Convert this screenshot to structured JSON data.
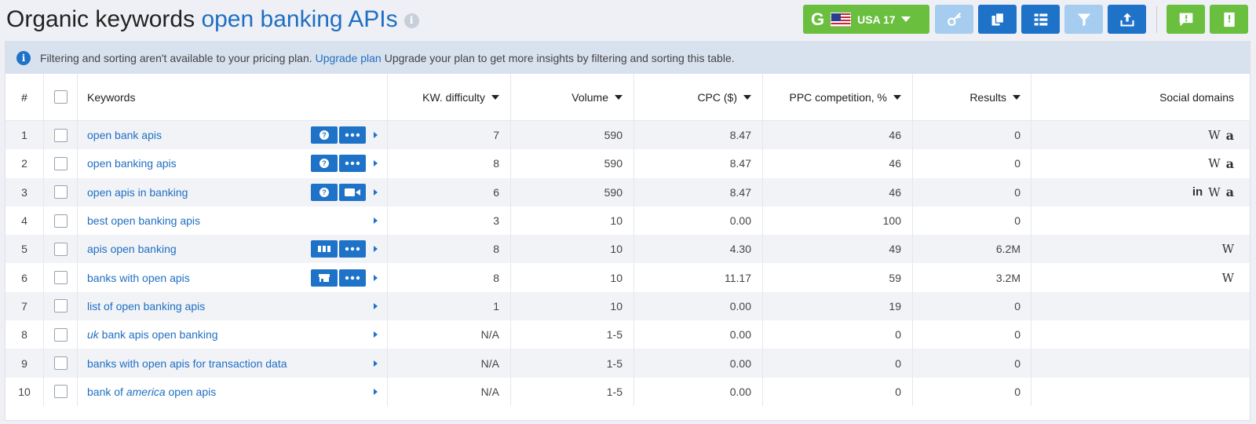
{
  "header": {
    "title_prefix": "Organic keywords",
    "title_query": "open banking APIs",
    "database": {
      "engine_letter": "G",
      "label": "USA 17"
    },
    "toolbar": [
      "key-icon",
      "copy-icon",
      "columns-icon",
      "filter-icon",
      "export-icon",
      "feedback-icon",
      "guide-icon"
    ]
  },
  "notice": {
    "text_before": "Filtering and sorting aren't available to your pricing plan.",
    "link": "Upgrade plan",
    "text_after": "Upgrade your plan to get more insights by filtering and sorting this table."
  },
  "table": {
    "columns": {
      "num": "#",
      "keywords": "Keywords",
      "kd": "KW. difficulty",
      "volume": "Volume",
      "cpc": "CPC ($)",
      "ppc": "PPC competition, %",
      "results": "Results",
      "social": "Social domains"
    },
    "rows": [
      {
        "n": "1",
        "kw": [
          "open bank apis"
        ],
        "tools": [
          "question",
          "more"
        ],
        "kd": "7",
        "vol": "590",
        "cpc": "8.47",
        "ppc": "46",
        "res": "0",
        "social": [
          "W",
          "a"
        ]
      },
      {
        "n": "2",
        "kw": [
          "open banking apis"
        ],
        "tools": [
          "question",
          "more"
        ],
        "kd": "8",
        "vol": "590",
        "cpc": "8.47",
        "ppc": "46",
        "res": "0",
        "social": [
          "W",
          "a"
        ]
      },
      {
        "n": "3",
        "kw": [
          "open apis in banking"
        ],
        "tools": [
          "question",
          "video"
        ],
        "kd": "6",
        "vol": "590",
        "cpc": "8.47",
        "ppc": "46",
        "res": "0",
        "social": [
          "in",
          "W",
          "a"
        ]
      },
      {
        "n": "4",
        "kw": [
          "best open banking apis"
        ],
        "tools": [],
        "kd": "3",
        "vol": "10",
        "cpc": "0.00",
        "ppc": "100",
        "res": "0",
        "social": []
      },
      {
        "n": "5",
        "kw": [
          "apis open banking"
        ],
        "tools": [
          "grid",
          "more"
        ],
        "kd": "8",
        "vol": "10",
        "cpc": "4.30",
        "ppc": "49",
        "res": "6.2M",
        "social": [
          "W"
        ]
      },
      {
        "n": "6",
        "kw": [
          "banks with open apis"
        ],
        "tools": [
          "store",
          "more"
        ],
        "kd": "8",
        "vol": "10",
        "cpc": "11.17",
        "ppc": "59",
        "res": "3.2M",
        "social": [
          "W"
        ]
      },
      {
        "n": "7",
        "kw": [
          "list of open banking apis"
        ],
        "tools": [],
        "kd": "1",
        "vol": "10",
        "cpc": "0.00",
        "ppc": "19",
        "res": "0",
        "social": []
      },
      {
        "n": "8",
        "kw": [
          "",
          "uk",
          " bank apis open banking"
        ],
        "tools": [],
        "kd": "N/A",
        "vol": "1-5",
        "cpc": "0.00",
        "ppc": "0",
        "res": "0",
        "social": []
      },
      {
        "n": "9",
        "kw": [
          "banks with open apis for transaction data"
        ],
        "tools": [],
        "kd": "N/A",
        "vol": "1-5",
        "cpc": "0.00",
        "ppc": "0",
        "res": "0",
        "social": []
      },
      {
        "n": "10",
        "kw": [
          "bank of ",
          "america",
          " open apis"
        ],
        "tools": [],
        "kd": "N/A",
        "vol": "1-5",
        "cpc": "0.00",
        "ppc": "0",
        "res": "0",
        "social": []
      }
    ]
  }
}
